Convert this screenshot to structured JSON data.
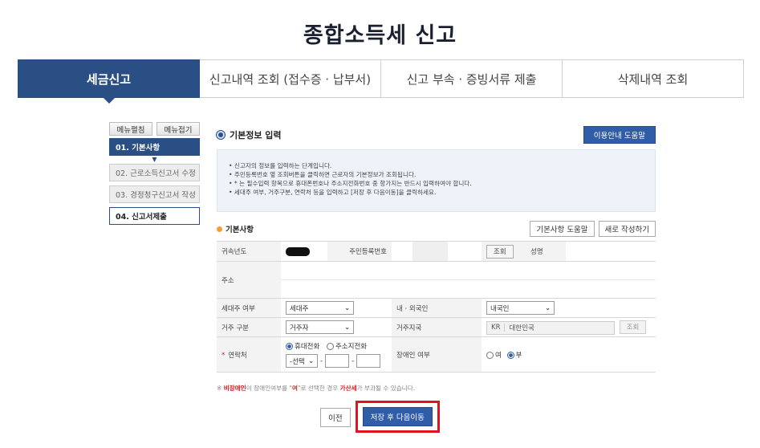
{
  "page_title": "종합소득세 신고",
  "tabs": [
    {
      "label": "세금신고",
      "active": true
    },
    {
      "label": "신고내역 조회 (접수증 · 납부서)"
    },
    {
      "label": "신고 부속 · 증빙서류 제출"
    },
    {
      "label": "삭제내역 조회"
    }
  ],
  "side_menu": {
    "expand_label": "메뉴펼침",
    "collapse_label": "메뉴접기",
    "steps": [
      "01. 기본사항",
      "02. 근로소득신고서 수정",
      "03. 경정청구신고서 작성",
      "04. 신고서제출"
    ]
  },
  "section": {
    "title": "기본정보 입력",
    "help_button": "이용안내 도움말",
    "guide_lines": [
      "신고자의 정보를 입력하는 단계입니다.",
      "주민등록번호 옆 조회버튼을 클릭하면 근로자의 기본정보가 조회됩니다.",
      "* 는 필수입력 항목으로 휴대폰번호나 주소지전화번호 중 항가지는 반드시 입력하여야 합니다.",
      "세대주 여부, 거주구분, 연락처 등을 입력하고 [저장 후 다음이동]을 클릭하세요."
    ]
  },
  "basic": {
    "title": "기본사항",
    "help_button": "기본사항 도움말",
    "new_button": "새로 작성하기",
    "year_label": "귀속년도",
    "ssn_label": "주민등록번호",
    "lookup_button": "조회",
    "name_label": "성명",
    "address_label": "주소",
    "head_label": "세대주 여부",
    "head_value": "세대주",
    "nationality_label": "내 · 외국인",
    "nationality_value": "내국인",
    "residence_label": "거주 구분",
    "residence_value": "거주자",
    "country_label": "거주지국",
    "country_code": "KR",
    "country_name": "대한민국",
    "country_lookup": "조회",
    "contact_label": "연락처",
    "required_mark": "*",
    "phone_mobile": "휴대전화",
    "phone_home": "주소지전화",
    "phone_select": "-선택",
    "dash": "-",
    "disabled_label": "장애인 여부",
    "opt_yes": "여",
    "opt_no": "부"
  },
  "note": {
    "prefix": "※ ",
    "red1": "비장애인",
    "mid1": "이 장애인여부를 \"",
    "red2": "여",
    "mid2": "\"로 선택한 경우 ",
    "red3": "가산세",
    "suffix": "가 부과될 수 있습니다."
  },
  "buttons": {
    "prev": "이전",
    "next": "저장 후 다음이동"
  }
}
